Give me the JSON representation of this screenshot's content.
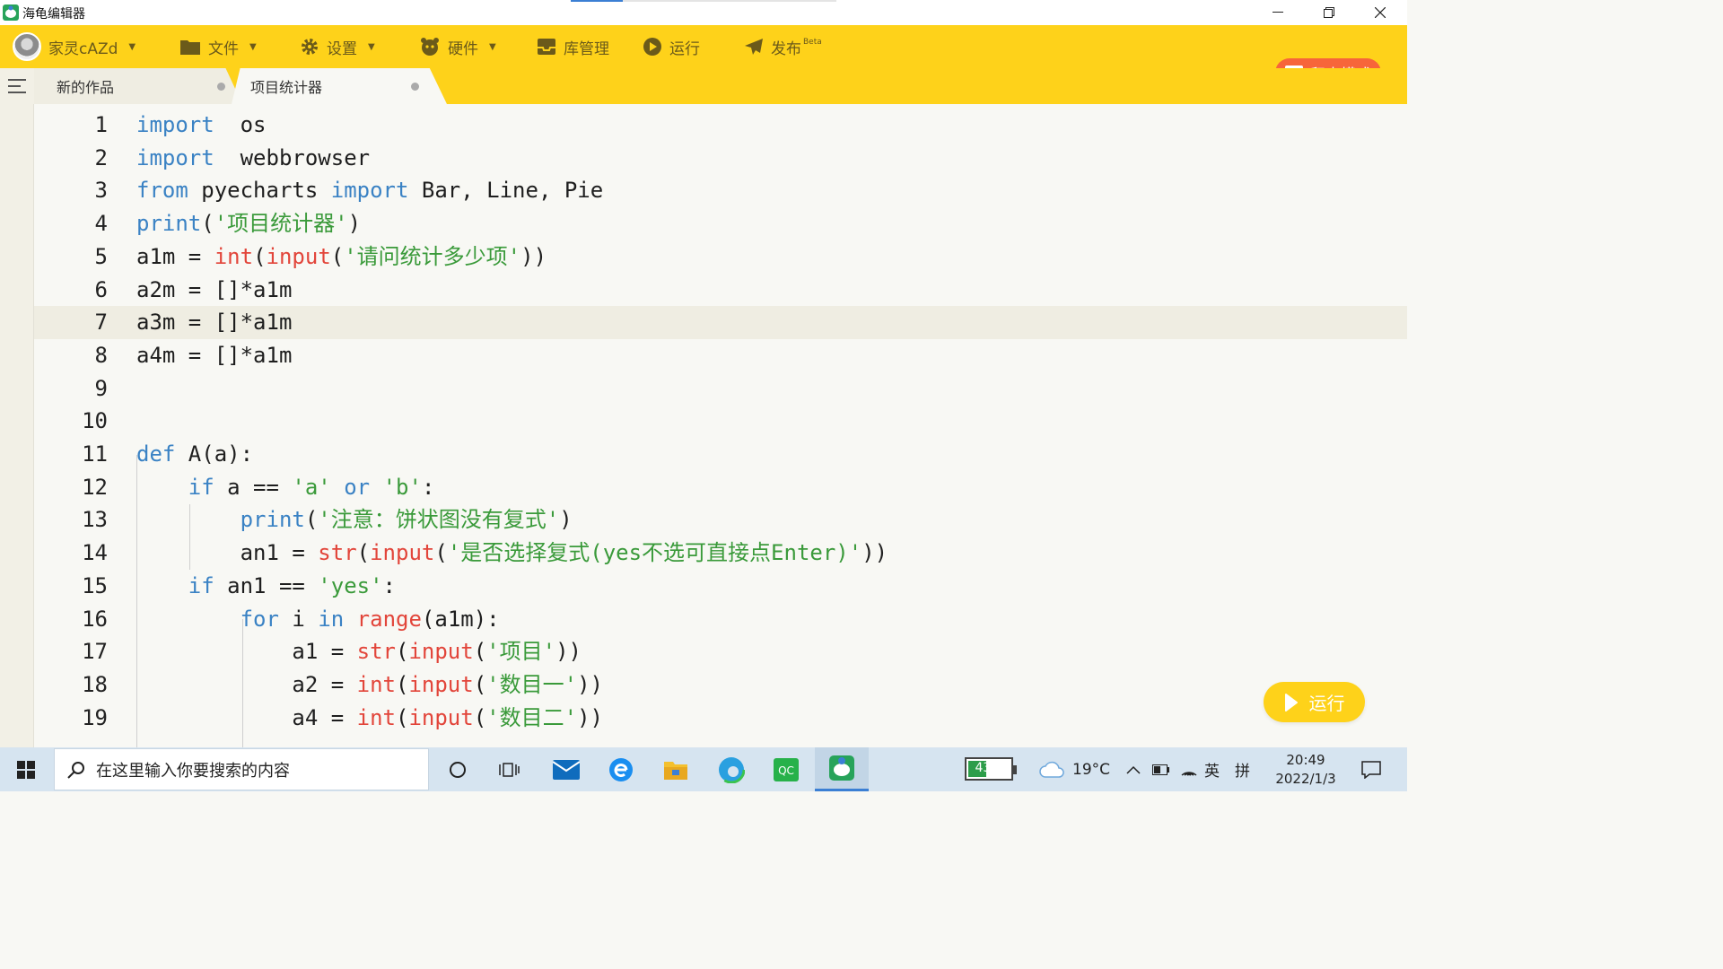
{
  "window": {
    "title": "海龟编辑器"
  },
  "toolbar": {
    "user": "家灵cAZd",
    "file": "文件",
    "settings": "设置",
    "hardware": "硬件",
    "library": "库管理",
    "run": "运行",
    "publish": "发布",
    "beta": "Beta",
    "block_mode": "积木模式"
  },
  "tabs": [
    {
      "label": "新的作品",
      "active": false
    },
    {
      "label": "项目统计器",
      "active": true
    }
  ],
  "editor": {
    "active_line": 7,
    "lines": [
      {
        "n": "1",
        "tokens": [
          [
            "kw",
            "import"
          ],
          [
            "",
            "  os"
          ]
        ]
      },
      {
        "n": "2",
        "tokens": [
          [
            "kw",
            "import"
          ],
          [
            "",
            "  webbrowser"
          ]
        ]
      },
      {
        "n": "3",
        "tokens": [
          [
            "kw",
            "from"
          ],
          [
            "",
            " pyecharts "
          ],
          [
            "kw",
            "import"
          ],
          [
            "",
            " Bar, Line, Pie"
          ]
        ]
      },
      {
        "n": "4",
        "tokens": [
          [
            "kw",
            "print"
          ],
          [
            "",
            "("
          ],
          [
            "st",
            "'项目统计器'"
          ],
          [
            "",
            ")"
          ]
        ]
      },
      {
        "n": "5",
        "tokens": [
          [
            "",
            "a1m = "
          ],
          [
            "bi",
            "int"
          ],
          [
            "",
            "("
          ],
          [
            "bi",
            "input"
          ],
          [
            "",
            "("
          ],
          [
            "st",
            "'请问统计多少项'"
          ],
          [
            "",
            "))"
          ]
        ]
      },
      {
        "n": "6",
        "tokens": [
          [
            "",
            "a2m = []*a1m"
          ]
        ]
      },
      {
        "n": "7",
        "tokens": [
          [
            "",
            "a3m = []*a1m"
          ]
        ]
      },
      {
        "n": "8",
        "tokens": [
          [
            "",
            "a4m = []*a1m"
          ]
        ]
      },
      {
        "n": "9",
        "tokens": []
      },
      {
        "n": "10",
        "tokens": []
      },
      {
        "n": "11",
        "tokens": [
          [
            "kw",
            "def"
          ],
          [
            "",
            " A(a):"
          ]
        ]
      },
      {
        "n": "12",
        "tokens": [
          [
            "",
            "    "
          ],
          [
            "kw",
            "if"
          ],
          [
            "",
            " a == "
          ],
          [
            "st",
            "'a'"
          ],
          [
            "",
            ""
          ],
          [
            "",
            " "
          ],
          [
            "kw",
            "or"
          ],
          [
            "",
            " "
          ],
          [
            "st",
            "'b'"
          ],
          [
            "",
            ":"
          ]
        ]
      },
      {
        "n": "13",
        "tokens": [
          [
            "",
            "        "
          ],
          [
            "kw",
            "print"
          ],
          [
            "",
            "("
          ],
          [
            "st",
            "'注意：饼状图没有复式'"
          ],
          [
            "",
            ")"
          ]
        ]
      },
      {
        "n": "14",
        "tokens": [
          [
            "",
            "        an1 = "
          ],
          [
            "bi",
            "str"
          ],
          [
            "",
            "("
          ],
          [
            "bi",
            "input"
          ],
          [
            "",
            "("
          ],
          [
            "st",
            "'是否选择复式(yes不选可直接点Enter)'"
          ],
          [
            "",
            "))"
          ]
        ]
      },
      {
        "n": "15",
        "tokens": [
          [
            "",
            "    "
          ],
          [
            "kw",
            "if"
          ],
          [
            "",
            " an1 == "
          ],
          [
            "st",
            "'yes'"
          ],
          [
            "",
            ":"
          ]
        ]
      },
      {
        "n": "16",
        "tokens": [
          [
            "",
            "        "
          ],
          [
            "kw",
            "for"
          ],
          [
            "",
            " i "
          ],
          [
            "kw",
            "in"
          ],
          [
            "",
            " "
          ],
          [
            "bi",
            "range"
          ],
          [
            "",
            "(a1m):"
          ]
        ]
      },
      {
        "n": "17",
        "tokens": [
          [
            "",
            "            a1 = "
          ],
          [
            "bi",
            "str"
          ],
          [
            "",
            "("
          ],
          [
            "bi",
            "input"
          ],
          [
            "",
            "("
          ],
          [
            "st",
            "'项目'"
          ],
          [
            "",
            "))"
          ]
        ]
      },
      {
        "n": "18",
        "tokens": [
          [
            "",
            "            a2 = "
          ],
          [
            "bi",
            "int"
          ],
          [
            "",
            "("
          ],
          [
            "bi",
            "input"
          ],
          [
            "",
            "("
          ],
          [
            "st",
            "'数目一'"
          ],
          [
            "",
            "))"
          ]
        ]
      },
      {
        "n": "19",
        "tokens": [
          [
            "",
            "            a4 = "
          ],
          [
            "bi",
            "int"
          ],
          [
            "",
            "("
          ],
          [
            "bi",
            "input"
          ],
          [
            "",
            "("
          ],
          [
            "st",
            "'数目二'"
          ],
          [
            "",
            "))"
          ]
        ]
      }
    ],
    "run_button": "运行"
  },
  "taskbar": {
    "search_placeholder": "在这里输入你要搜索的内容",
    "battery": "43%",
    "battery_level": 0.43,
    "weather": "19°C",
    "ime_lang": "英",
    "ime_mode": "拼",
    "time": "20:49",
    "date": "2022/1/3"
  },
  "colors": {
    "toolbar": "#fed21a",
    "accent": "#f7653a",
    "keyword": "#3a82c4",
    "builtin": "#e2453a",
    "string": "#3a9a3a"
  }
}
